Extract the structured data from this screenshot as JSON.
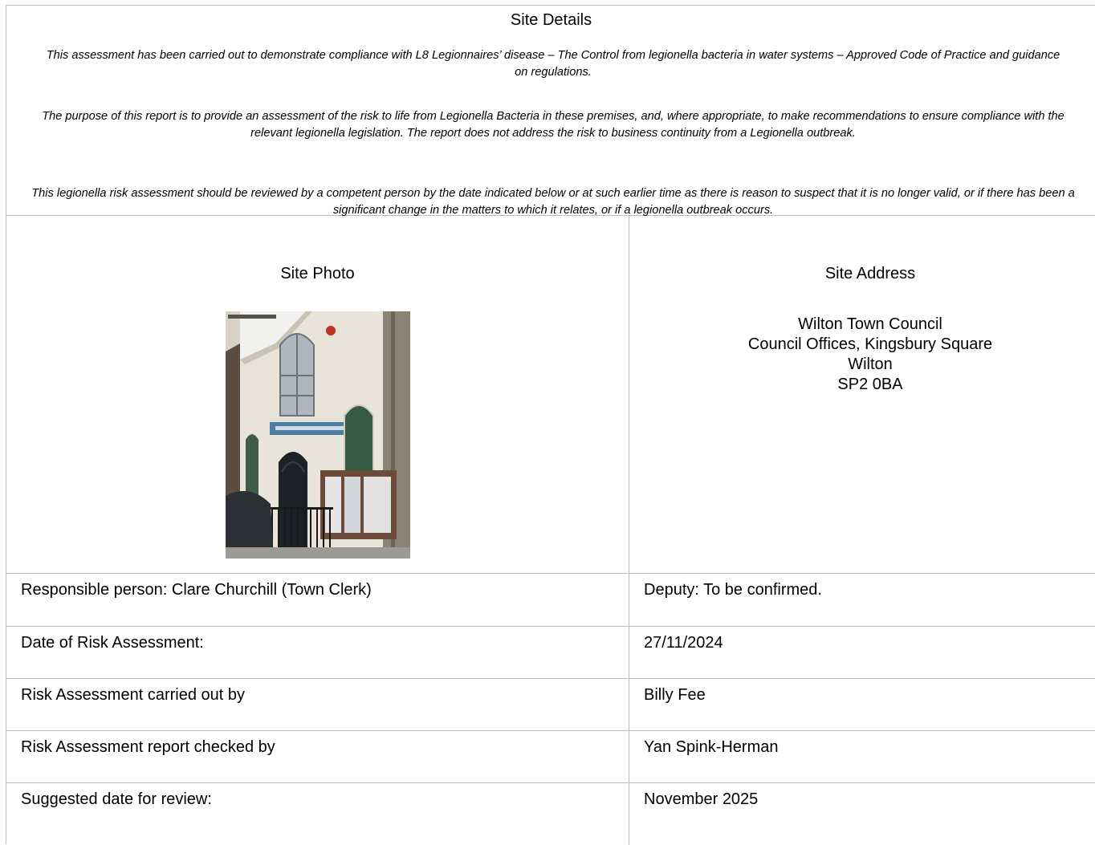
{
  "site_details": {
    "heading": "Site Details",
    "paragraphs": [
      "This assessment has been carried out to demonstrate compliance with L8 Legionnaires’ disease – The Control from legionella bacteria in water systems – Approved Code of Practice and guidance on regulations.",
      "The purpose of this report is to provide an assessment of the risk to life from Legionella Bacteria in these premises, and, where appropriate, to make recommendations to ensure compliance with the relevant legionella legislation. The report does not address the risk to business continuity from a Legionella outbreak.",
      "This legionella risk assessment should be reviewed by a competent person by the date indicated below or at such earlier time as there is reason to suspect that it is no longer valid, or if there has been a significant change in the matters to which it relates, or if a legionella outbreak occurs."
    ]
  },
  "site_photo": {
    "heading": "Site Photo"
  },
  "site_address": {
    "heading": "Site Address",
    "lines": [
      "Wilton Town Council",
      "Council Offices, Kingsbury Square",
      "Wilton",
      "SP2 0BA"
    ]
  },
  "details": [
    {
      "label": "Responsible person: Clare Churchill (Town Clerk)",
      "value": "Deputy: To be confirmed."
    },
    {
      "label": "Date of Risk Assessment:",
      "value": "27/11/2024"
    },
    {
      "label": "Risk Assessment carried out by",
      "value": "Billy Fee"
    },
    {
      "label": "Risk Assessment report checked by",
      "value": "Yan Spink-Herman"
    },
    {
      "label": "Suggested date for review:",
      "value": "November 2025"
    }
  ]
}
